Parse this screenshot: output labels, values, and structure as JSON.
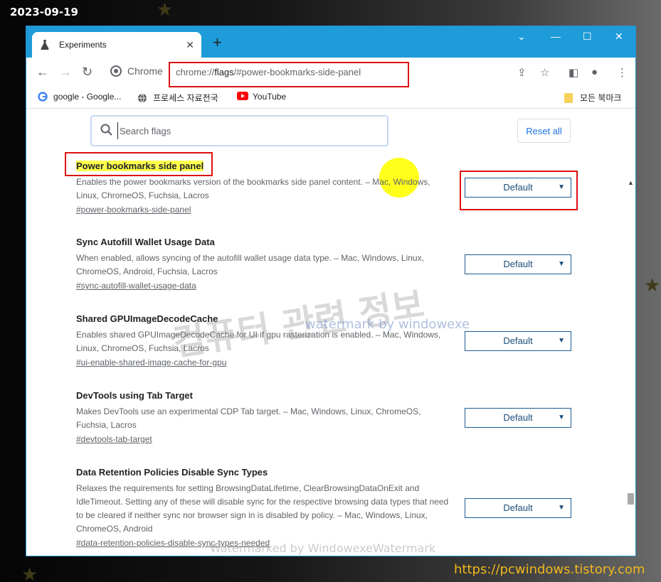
{
  "overlay": {
    "date": "2023-09-19",
    "site_url": "https://pcwindows.tistory.com"
  },
  "tab": {
    "title": "Experiments",
    "close": "✕",
    "new_tab": "+"
  },
  "window_controls": {
    "chevron": "⌄",
    "minimize": "—",
    "maximize": "☐",
    "close": "✕"
  },
  "toolbar": {
    "chrome_label": "Chrome",
    "url_scheme": "chrome://",
    "url_host": "flags",
    "url_rest": "/#power-bookmarks-side-panel"
  },
  "bookmarks": [
    {
      "label": "google - Google...",
      "icon": "google-icon"
    },
    {
      "label": "프로세스 자료전국",
      "icon": "globe-icon"
    },
    {
      "label": "YouTube",
      "icon": "youtube-icon"
    },
    {
      "label": "모든 북마크",
      "icon": "folder-icon"
    }
  ],
  "search": {
    "placeholder": "Search flags",
    "value": ""
  },
  "reset_label": "Reset all",
  "flags": [
    {
      "title": "Power bookmarks side panel",
      "desc": "Enables the power bookmarks version of the bookmarks side panel content. – Mac, Windows, Linux, ChromeOS, Fuchsia, Lacros",
      "link": "#power-bookmarks-side-panel",
      "value": "Default"
    },
    {
      "title": "Sync Autofill Wallet Usage Data",
      "desc": "When enabled, allows syncing of the autofill wallet usage data type. – Mac, Windows, Linux, ChromeOS, Android, Fuchsia, Lacros",
      "link": "#sync-autofill-wallet-usage-data",
      "value": "Default"
    },
    {
      "title": "Shared GPUImageDecodeCache",
      "desc": "Enables shared GPUImageDecodeCache for UI if gpu rasterization is enabled. – Mac, Windows, Linux, ChromeOS, Fuchsia, Lacros",
      "link": "#ui-enable-shared-image-cache-for-gpu",
      "value": "Default"
    },
    {
      "title": "DevTools using Tab Target",
      "desc": "Makes DevTools use an experimental CDP Tab target. – Mac, Windows, Linux, ChromeOS, Fuchsia, Lacros",
      "link": "#devtools-tab-target",
      "value": "Default"
    },
    {
      "title": "Data Retention Policies Disable Sync Types",
      "desc": "Relaxes the requirements for setting BrowsingDataLifetime, ClearBrowsingDataOnExit and IdleTimeout. Setting any of these will disable sync for the respective browsing data types that need to be cleared if neither sync nor browser sign in is disabled by policy. – Mac, Windows, Linux, ChromeOS, Android",
      "link": "#data-retention-policies-disable-sync-types-needed",
      "value": "Default"
    }
  ],
  "watermarks": {
    "korean": "컴퓨터 관련 정보",
    "by": "watermark by windowexe",
    "bottom": "Watermarked by WindowexeWatermark"
  }
}
